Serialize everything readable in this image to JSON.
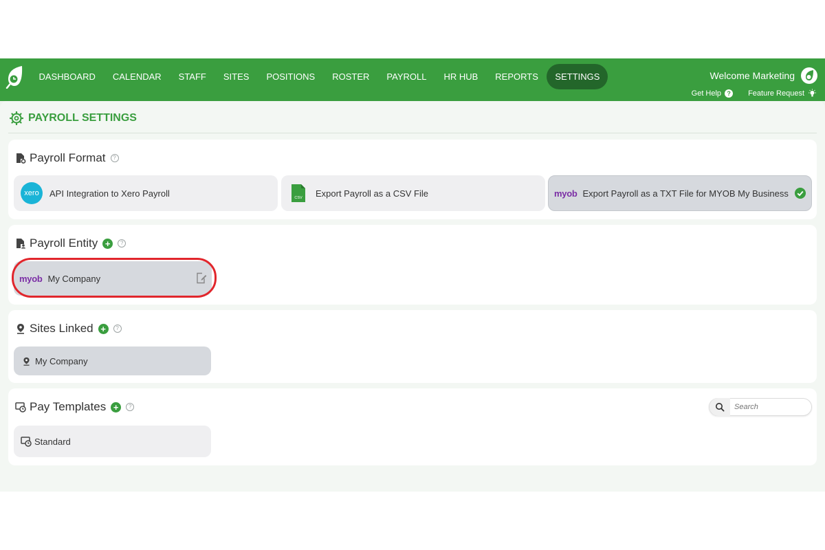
{
  "nav": {
    "items": [
      "DASHBOARD",
      "CALENDAR",
      "STAFF",
      "SITES",
      "POSITIONS",
      "ROSTER",
      "PAYROLL",
      "HR HUB",
      "REPORTS",
      "SETTINGS"
    ],
    "active": "SETTINGS",
    "welcome": "Welcome Marketing",
    "get_help": "Get Help",
    "feature_request": "Feature Request"
  },
  "page": {
    "title": "PAYROLL SETTINGS"
  },
  "payroll_format": {
    "heading": "Payroll Format",
    "options": [
      {
        "logo": "xero",
        "label": "API Integration to Xero Payroll",
        "selected": false
      },
      {
        "logo": "csv",
        "label": "Export Payroll as a CSV File",
        "selected": false
      },
      {
        "logo": "myob",
        "label": "Export Payroll as a TXT File for MYOB My Business",
        "selected": true
      }
    ],
    "logo_text": {
      "xero": "xero",
      "csv": "CSV",
      "myob": "myob"
    }
  },
  "payroll_entity": {
    "heading": "Payroll Entity",
    "entity": {
      "logo": "myob",
      "name": "My Company"
    }
  },
  "sites_linked": {
    "heading": "Sites Linked",
    "site": "My Company"
  },
  "pay_templates": {
    "heading": "Pay Templates",
    "search_placeholder": "Search",
    "template": "Standard"
  },
  "colors": {
    "brand_green": "#3a9e3f",
    "active_nav": "#23662a",
    "highlight_ring": "#e1262c",
    "myob_purple": "#7b2ea5",
    "xero_blue": "#1ab4d7"
  }
}
